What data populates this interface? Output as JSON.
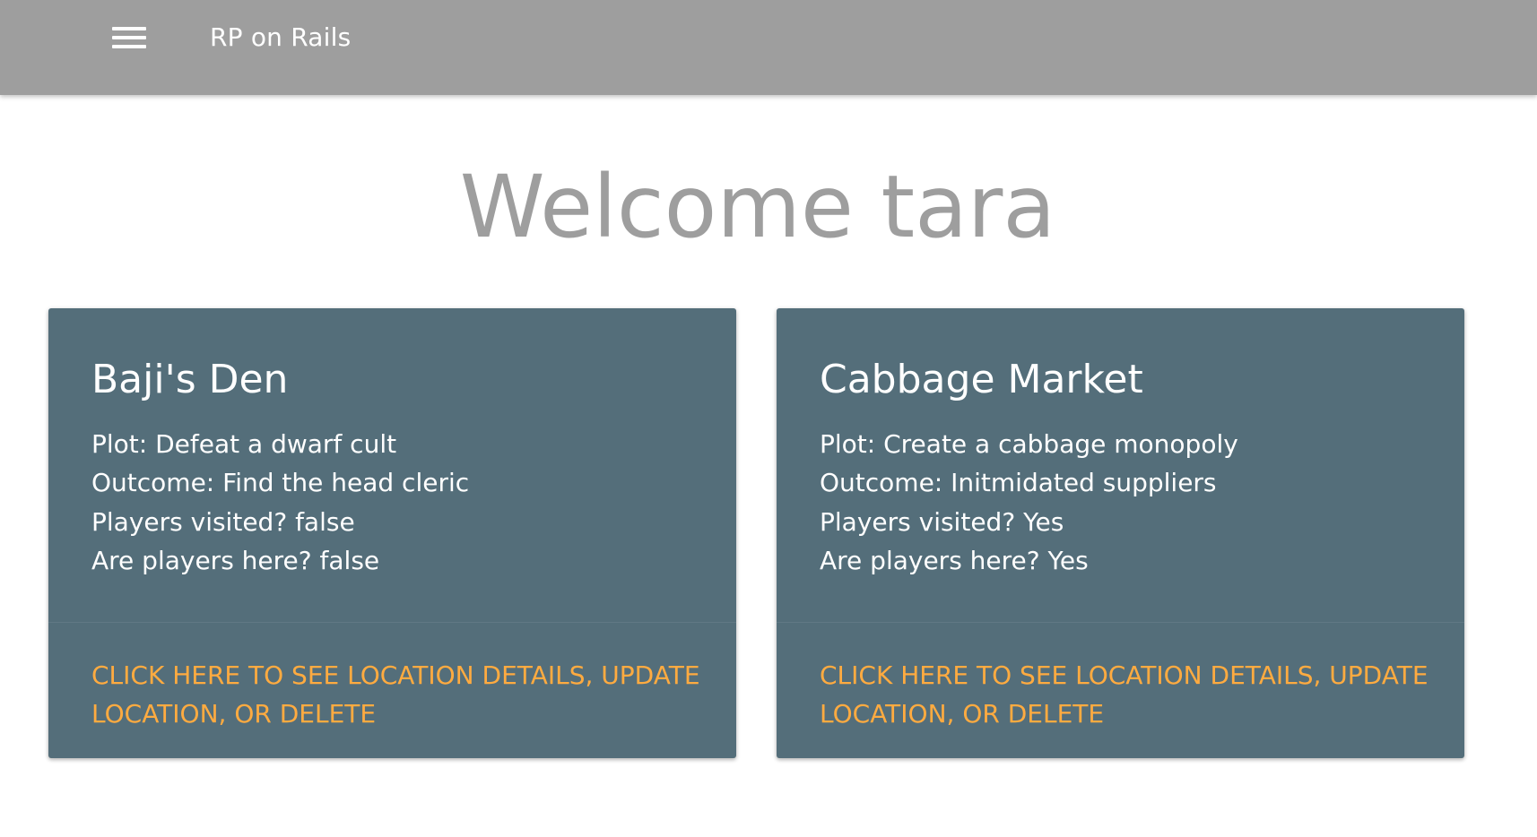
{
  "navbar": {
    "menu_icon": "hamburger-menu-icon",
    "brand": "RP on Rails",
    "background_color": "#9e9e9e"
  },
  "main": {
    "welcome": "Welcome tara"
  },
  "cards": [
    {
      "title": "Baji's Den",
      "plot": "Plot: Defeat a dwarf cult",
      "outcome": "Outcome: Find the head cleric",
      "visited": "Players visited? false",
      "here": "Are players here? false",
      "action": "CLICK HERE TO SEE LOCATION DETAILS, UPDATE LOCATION, OR DELETE"
    },
    {
      "title": "Cabbage Market",
      "plot": "Plot: Create a cabbage monopoly",
      "outcome": "Outcome: Initmidated suppliers",
      "visited": "Players visited? Yes",
      "here": "Are players here? Yes",
      "action": "CLICK HERE TO SEE LOCATION DETAILS, UPDATE LOCATION, OR DELETE"
    }
  ],
  "colors": {
    "card_background": "#546e7a",
    "action_link": "#ffab40",
    "welcome_text": "#9e9e9e"
  }
}
